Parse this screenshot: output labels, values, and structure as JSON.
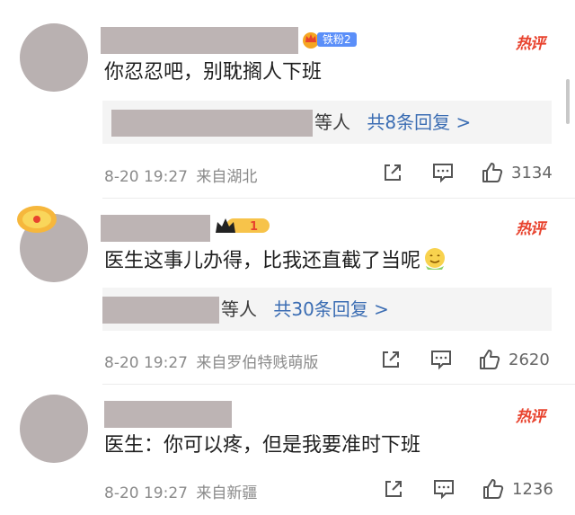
{
  "comments": [
    {
      "fan_badge": "铁粉2",
      "hot_label": "热评",
      "text": "你忍忍吧，别耽搁人下班",
      "reply_suffix": "等人",
      "reply_count": "共8条回复 >",
      "timestamp": "8-20 19:27",
      "location": "来自湖北",
      "likes": "3134"
    },
    {
      "level_badge": "1",
      "hot_label": "热评",
      "text": "医生这事儿办得，比我还直截了当呢",
      "reply_suffix": "等人",
      "reply_count": "共30条回复 >",
      "timestamp": "8-20 19:27",
      "location": "来自罗伯特贱萌版",
      "likes": "2620"
    },
    {
      "hot_label": "热评",
      "text": "医生：你可以疼，但是我要准时下班",
      "timestamp": "8-20 19:27",
      "location": "来自新疆",
      "likes": "1236"
    }
  ],
  "icons": {
    "share": "share-icon",
    "comment": "comment-icon",
    "like": "thumbs-up-icon"
  },
  "colors": {
    "hot": "#e8432e",
    "link": "#3b6db3",
    "meta": "#8a8a8a",
    "reply_bg": "#f4f4f4"
  }
}
